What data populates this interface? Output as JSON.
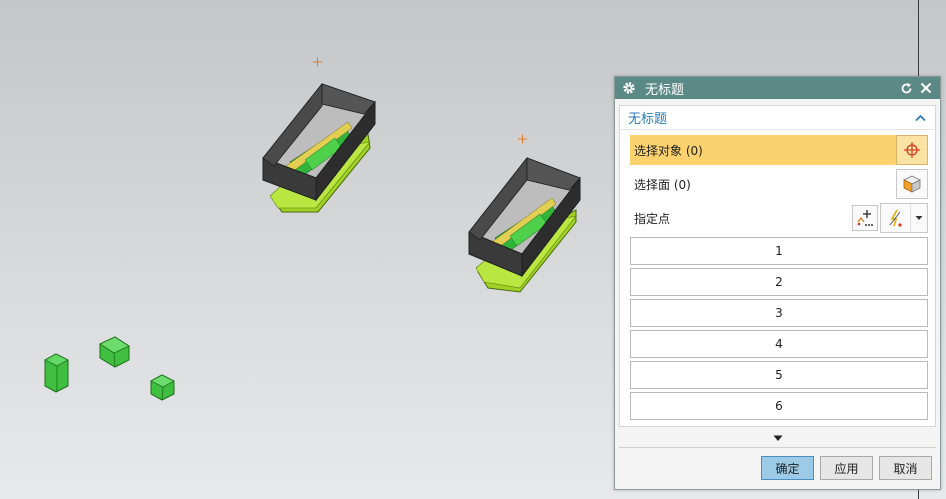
{
  "dialog": {
    "title": "无标题",
    "section_title": "无标题",
    "rows": {
      "select_object": "选择对象 (0)",
      "select_face": "选择面 (0)",
      "specify_point": "指定点"
    },
    "list_items": [
      "1",
      "2",
      "3",
      "4",
      "5",
      "6"
    ],
    "buttons": {
      "ok": "确定",
      "apply": "应用",
      "cancel": "取消"
    },
    "icons": {
      "title": "gear-icon",
      "reset": "reset-icon",
      "close": "close-icon",
      "collapse": "chevron-up-icon",
      "select_object": "crosshair-icon",
      "select_face": "cube-face-icon",
      "point_dialog": "point-dialog-icon",
      "inferred_point": "inferred-point-icon",
      "expand": "triangle-down-icon"
    }
  },
  "colors": {
    "titlebar": "#5b8a86",
    "selected_row": "#fbd26d",
    "section_title": "#2c7cb8",
    "ok_button": "#9ccbe7",
    "viewport_top": "#c4c6c8",
    "viewport_bottom": "#e8e9ea"
  }
}
